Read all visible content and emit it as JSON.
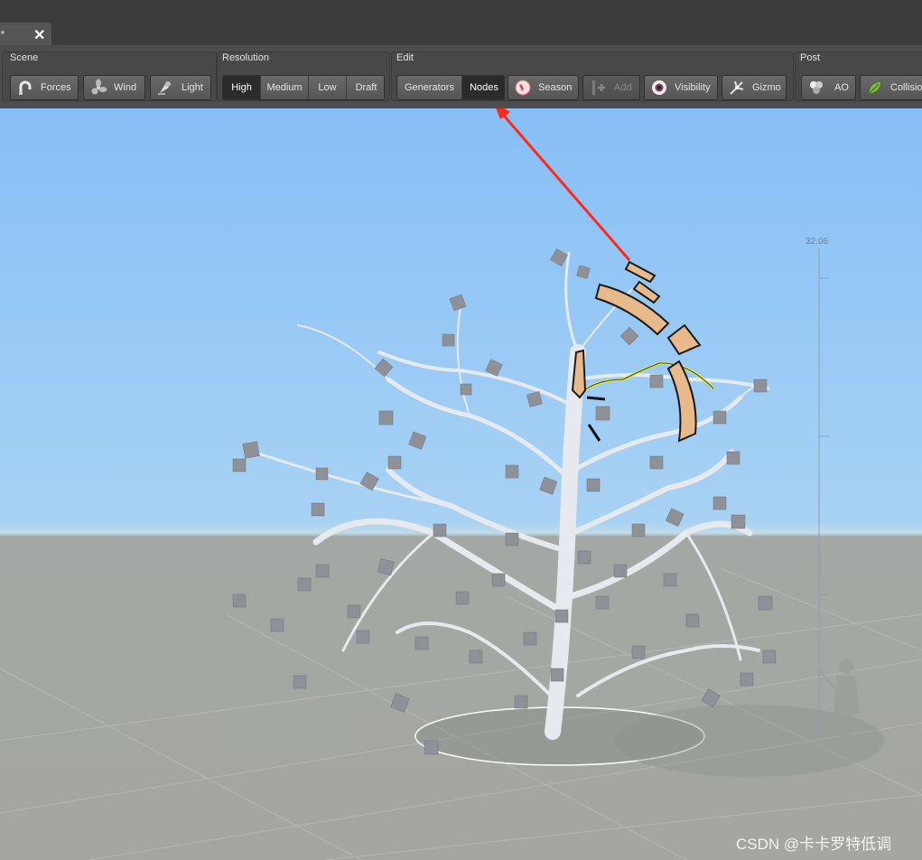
{
  "document_tab": {
    "title": "e*",
    "close_icon": "close-icon"
  },
  "toolbar": {
    "scene": {
      "label": "Scene",
      "buttons": [
        {
          "label": "Forces",
          "icon": "magnet-icon"
        },
        {
          "label": "Wind",
          "icon": "fan-icon"
        },
        {
          "label": "Light",
          "icon": "lamp-icon"
        }
      ]
    },
    "resolution": {
      "label": "Resolution",
      "options": [
        "High",
        "Medium",
        "Low",
        "Draft"
      ],
      "selected": "High"
    },
    "edit": {
      "label": "Edit",
      "modes": [
        "Generators",
        "Nodes"
      ],
      "selected": "Nodes",
      "buttons": [
        {
          "label": "Season",
          "icon": "globe-icon",
          "enabled": true
        },
        {
          "label": "Add",
          "icon": "add-node-icon",
          "enabled": false
        },
        {
          "label": "Visibility",
          "icon": "eye-icon",
          "enabled": true
        },
        {
          "label": "Gizmo",
          "icon": "gizmo-icon",
          "enabled": true
        }
      ]
    },
    "post": {
      "label": "Post",
      "buttons": [
        {
          "label": "AO",
          "icon": "ao-icon"
        },
        {
          "label": "Collision",
          "icon": "leaf-icon"
        }
      ]
    }
  },
  "viewport": {
    "height_ruler_value": "32.06",
    "watermark": "CSDN @卡卡罗特低调"
  },
  "colors": {
    "annotation_arrow": "#ff2a1a",
    "gizmo_fill": "#e8b98a",
    "selection_highlight": "#e8f23c",
    "sky": "#86bff6",
    "ground": "#a3a79f"
  }
}
